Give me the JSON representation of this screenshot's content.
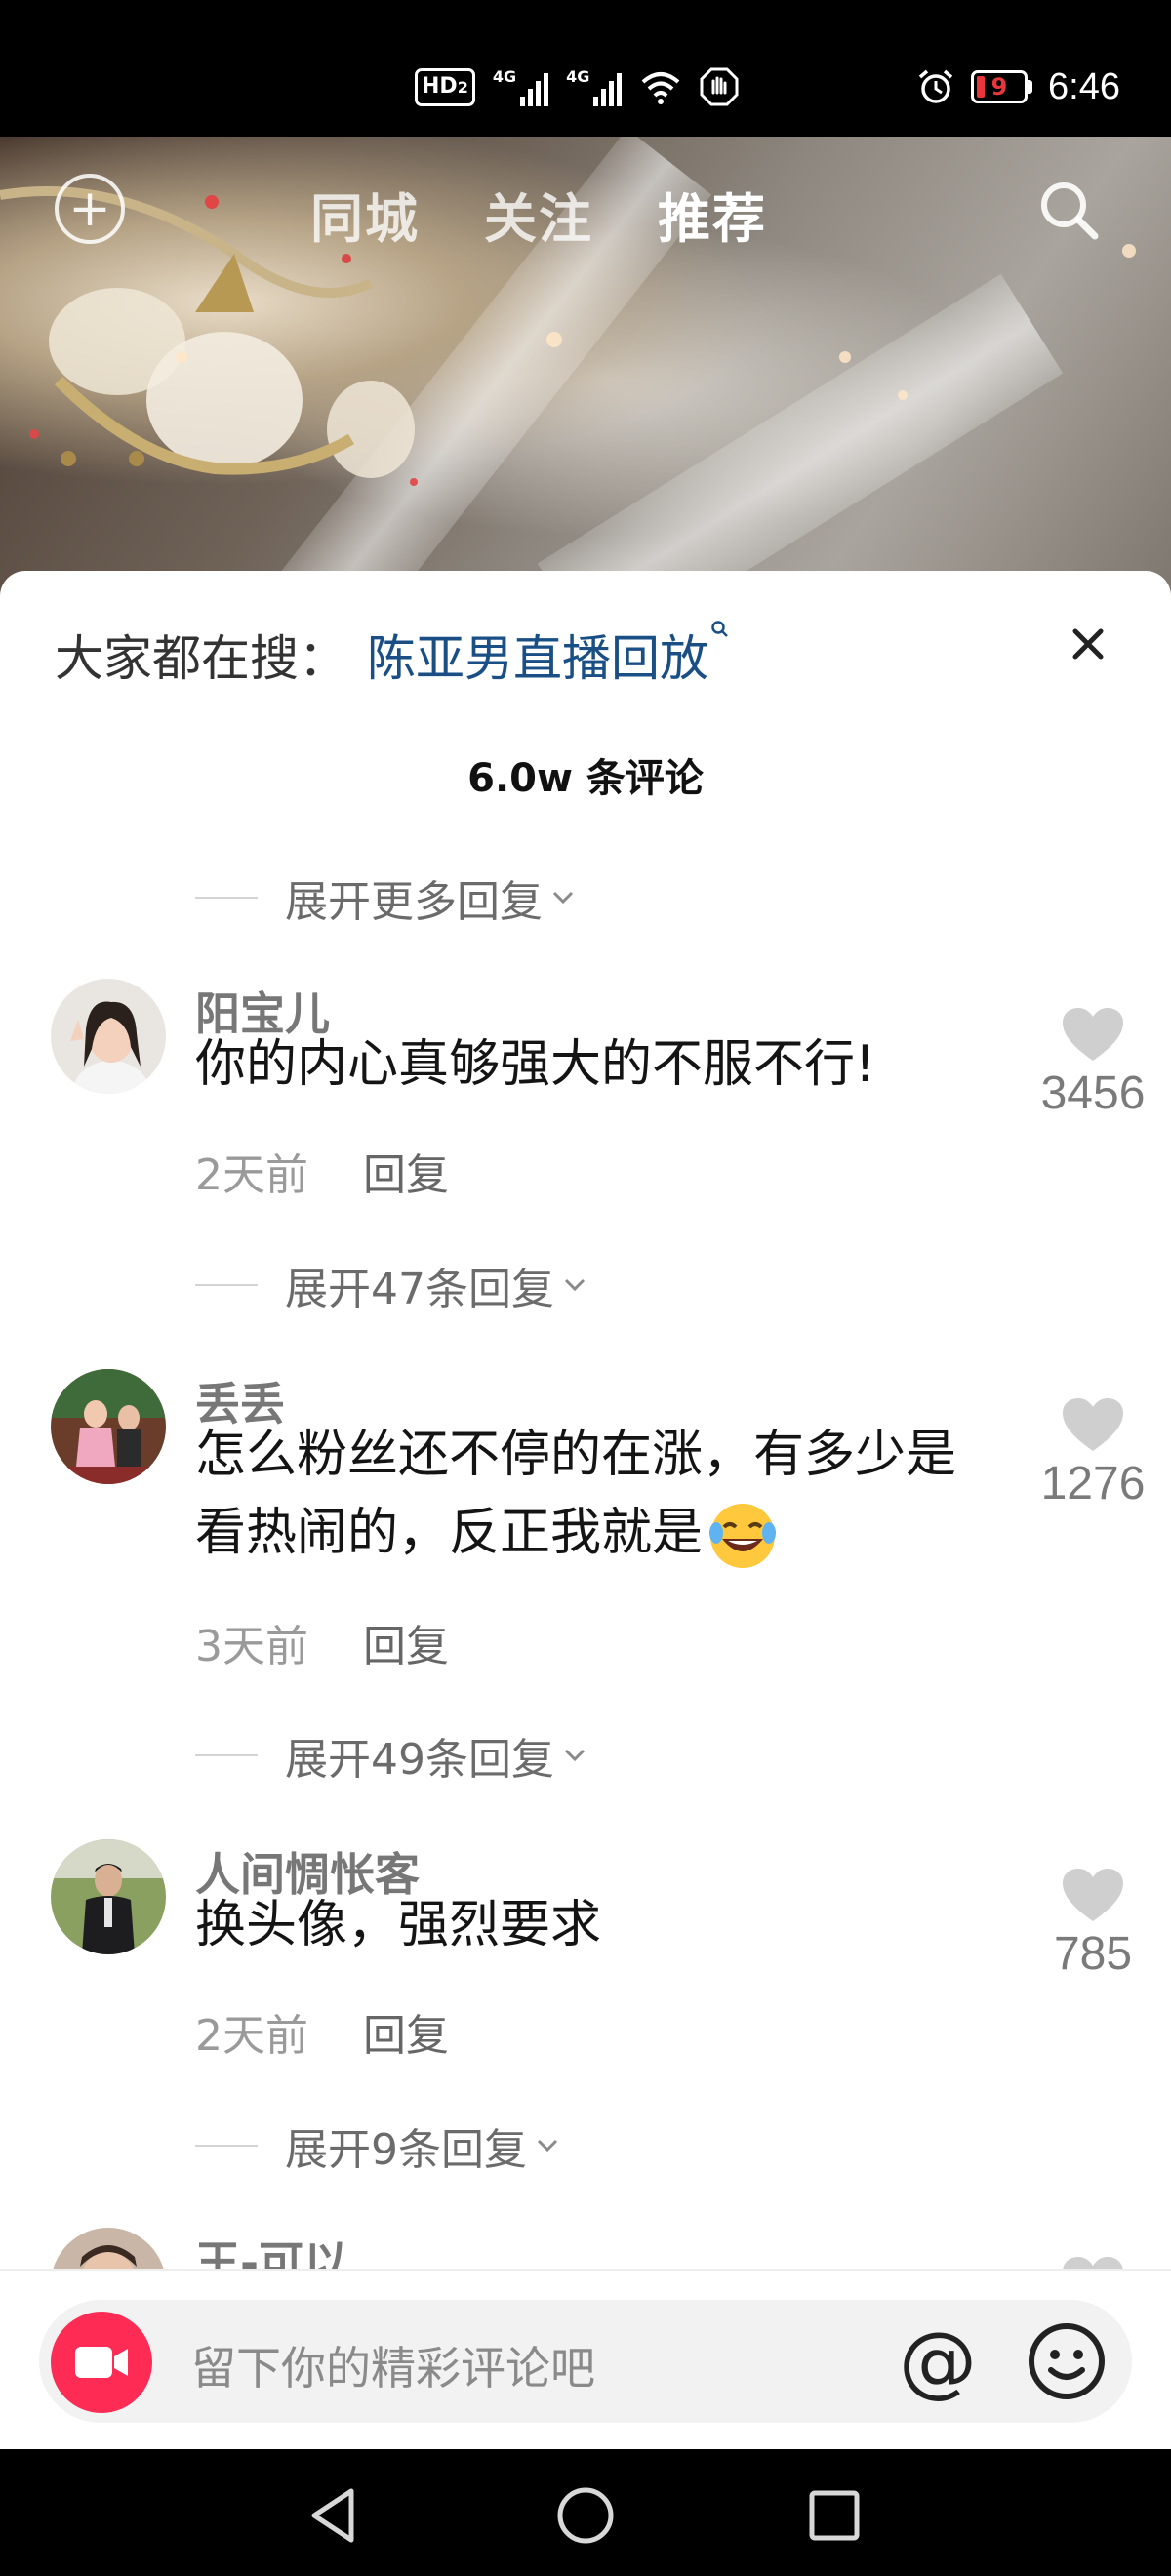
{
  "status_bar": {
    "hd": "HD",
    "hd_sub": "2",
    "net1": "4G",
    "net2": "4G",
    "battery": "9",
    "time": "6:46",
    "icons": [
      "hd-icon",
      "signal-icon",
      "wifi-icon",
      "hand-icon",
      "alarm-icon",
      "battery-icon"
    ]
  },
  "top_nav": {
    "tabs": [
      {
        "label": "同城"
      },
      {
        "label": "关注"
      },
      {
        "label": "推荐"
      }
    ],
    "active_tab": "推荐"
  },
  "comments_sheet": {
    "search_prefix": "大家都在搜：",
    "search_term": "陈亚男直播回放",
    "count_title": "6.0w 条评论",
    "expand_more": "展开更多回复",
    "comments": [
      {
        "name": "阳宝儿",
        "text": "你的内心真够强大的不服不行!",
        "time": "2天前",
        "reply": "回复",
        "likes": "3456",
        "expand": "展开47条回复"
      },
      {
        "name": "丢丢",
        "text": "怎么粉丝还不停的在涨，有多少是看热闹的，反正我就是",
        "emoji": "laughing-tears-emoji",
        "time": "3天前",
        "reply": "回复",
        "likes": "1276",
        "expand": "展开49条回复"
      },
      {
        "name": "人间惆怅客",
        "text": "换头像，强烈要求",
        "time": "2天前",
        "reply": "回复",
        "likes": "785",
        "expand": "展开9条回复"
      },
      {
        "name": "王-可以"
      }
    ]
  },
  "input_bar": {
    "placeholder": "留下你的精彩评论吧",
    "at_symbol": "@"
  },
  "colors": {
    "accent": "#fe2c55",
    "link": "#1a4f86",
    "battery_low": "#e8373a"
  }
}
